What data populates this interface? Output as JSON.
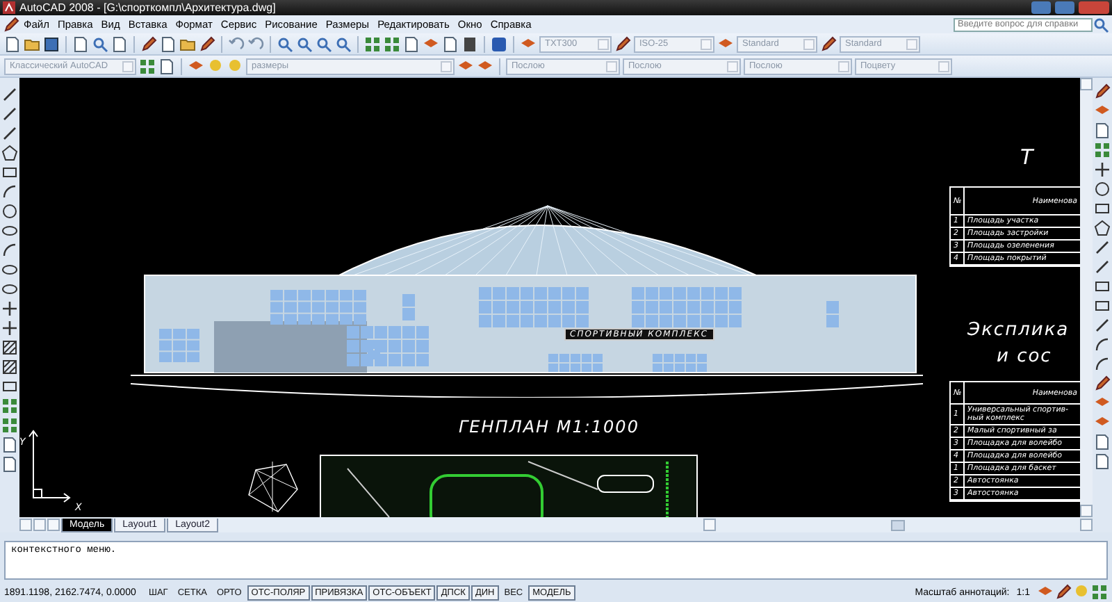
{
  "window": {
    "title": "AutoCAD 2008 - [G:\\спорткомпл\\Архитектура.dwg]"
  },
  "menu": [
    "Файл",
    "Правка",
    "Вид",
    "Вставка",
    "Формат",
    "Сервис",
    "Рисование",
    "Размеры",
    "Редактировать",
    "Окно",
    "Справка"
  ],
  "help_search": {
    "placeholder": "Введите вопрос для справки"
  },
  "style_dropdowns": [
    {
      "value": "TXT300"
    },
    {
      "value": "ISO-25"
    },
    {
      "value": "Standard"
    },
    {
      "value": "Standard"
    }
  ],
  "properties_bar": {
    "workspace": "Классический AutoCAD",
    "layer": "размеры",
    "color_control": "Послою",
    "linetype": "Послою",
    "lineweight": "Послою",
    "plot_style": "Поцвету"
  },
  "drawing": {
    "building_sign": "СПОРТИВНЫЙ КОМПЛЕКС",
    "site_plan_title": "ГЕНПЛАН М1:1000",
    "table1": {
      "title": "Т",
      "header_no": "№",
      "header": "Наименова",
      "rows": [
        {
          "no": "1",
          "lines": [
            "Площадь участка"
          ]
        },
        {
          "no": "2",
          "lines": [
            "Площадь застройки"
          ]
        },
        {
          "no": "3",
          "lines": [
            "Площадь озеленения"
          ]
        },
        {
          "no": "4",
          "lines": [
            "Площадь покрытий"
          ]
        }
      ]
    },
    "table2": {
      "title_lines": [
        "Эксплика",
        "и сос"
      ],
      "header_no": "№",
      "header": "Наименова",
      "rows": [
        {
          "no": "1",
          "lines": [
            "Универсальный спортив-",
            "ный комплекс"
          ]
        },
        {
          "no": "2",
          "lines": [
            "Малый спортивный за"
          ]
        },
        {
          "no": "3",
          "lines": [
            "Площадка для волейбо"
          ]
        },
        {
          "no": "4",
          "lines": [
            "Площадка для волейбо"
          ]
        },
        {
          "no": "1",
          "lines": [
            "Площадка для баскет"
          ]
        },
        {
          "no": "2",
          "lines": [
            "Автостоянка"
          ]
        },
        {
          "no": "3",
          "lines": [
            "Автостоянка"
          ]
        }
      ]
    },
    "ucs": {
      "x": "X",
      "y": "Y"
    }
  },
  "layout_tabs": [
    {
      "label": "Модель",
      "selected": true
    },
    {
      "label": "Layout1",
      "selected": false
    },
    {
      "label": "Layout2",
      "selected": false
    }
  ],
  "command_line": {
    "history": "контекстного меню."
  },
  "status_bar": {
    "coordinates": "1891.1198, 2162.7474, 0.0000",
    "toggles": [
      {
        "label": "ШАГ",
        "on": false
      },
      {
        "label": "СЕТКА",
        "on": false
      },
      {
        "label": "ОРТО",
        "on": false
      },
      {
        "label": "ОТС-ПОЛЯР",
        "on": true
      },
      {
        "label": "ПРИВЯЗКА",
        "on": true
      },
      {
        "label": "ОТС-ОБЪЕКТ",
        "on": true
      },
      {
        "label": "ДПСК",
        "on": true
      },
      {
        "label": "ДИН",
        "on": true
      },
      {
        "label": "ВЕС",
        "on": false
      },
      {
        "label": "МОДЕЛЬ",
        "on": true
      }
    ],
    "annotation_scale_label": "Масштаб аннотаций:",
    "annotation_scale": "1:1"
  }
}
